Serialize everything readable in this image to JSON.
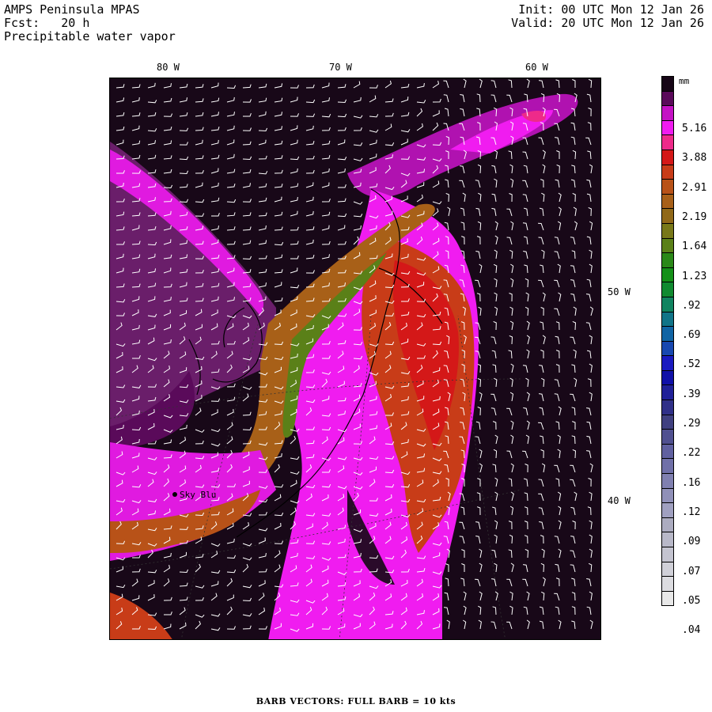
{
  "header": {
    "model": "AMPS Peninsula MPAS",
    "forecast": "Fcst:   20 h",
    "field": "Precipitable water vapor",
    "init": "Init: 00 UTC Mon 12 Jan 26",
    "valid": "Valid: 20 UTC Mon 12 Jan 26"
  },
  "map": {
    "lon_labels": [
      "80 W",
      "70 W",
      "60 W"
    ],
    "lat_labels": [
      "50 W",
      "40 W"
    ],
    "station": {
      "name": "Sky Blu",
      "marker": "filled-dot"
    },
    "background_color": "#180818",
    "map_features": [
      "coastline-contours",
      "lat-lon-grid-dotted",
      "wind-barbs"
    ]
  },
  "colorbar": {
    "units": "mm",
    "labels": [
      "5.16",
      "3.88",
      "2.91",
      "2.19",
      "1.64",
      "1.23",
      ".92",
      ".69",
      ".52",
      ".39",
      ".29",
      ".22",
      ".16",
      ".12",
      ".09",
      ".07",
      ".05",
      ".04"
    ],
    "colors": [
      "#160616",
      "#5a0a5a",
      "#c412c4",
      "#f01cf0",
      "#ee2a8a",
      "#d41818",
      "#c83c18",
      "#b85218",
      "#a86018",
      "#906818",
      "#787818",
      "#5a8018",
      "#2a8818",
      "#149018",
      "#108a30",
      "#108460",
      "#107488",
      "#1064a4",
      "#1848b0",
      "#1a1ac0",
      "#1010a8",
      "#202098",
      "#303088",
      "#404080",
      "#505090",
      "#6060a0",
      "#7070a8",
      "#8080b0",
      "#9090b8",
      "#a0a0c0",
      "#acacc0",
      "#b8b8c8",
      "#c4c4d0",
      "#d0d0d8",
      "#dcdce0",
      "#e8e8e8"
    ]
  },
  "footer": "BARB VECTORS:  FULL BARB = 10 kts"
}
